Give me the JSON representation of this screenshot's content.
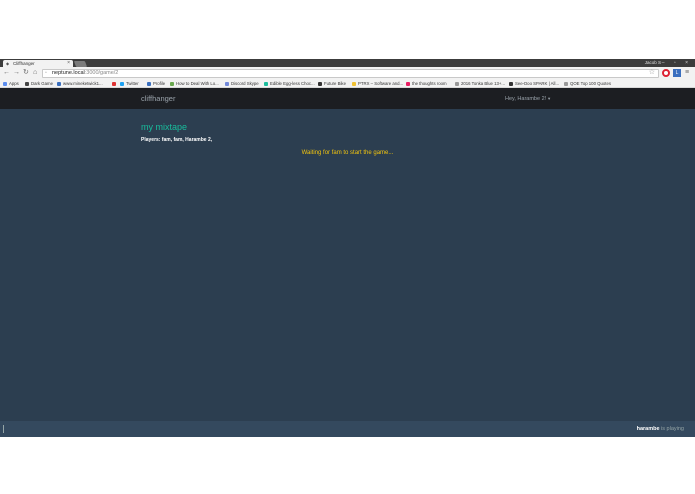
{
  "browser": {
    "tab_title": "Cliffhanger",
    "profile_name": "Jacob S",
    "window_controls": "– ▫ ×",
    "url_host": "neptune.local",
    "url_port_path": ":3000/game/2",
    "bookmarks": [
      {
        "label": "Apps",
        "color": "#5b8def"
      },
      {
        "label": "Dark Game",
        "color": "#444444"
      },
      {
        "label": "www.mineketwick1...",
        "color": "#3a6fbf"
      },
      {
        "label": "",
        "color": "#d33"
      },
      {
        "label": "Twitter",
        "color": "#1da1f2"
      },
      {
        "label": "Profile",
        "color": "#3a6fbf"
      },
      {
        "label": "How to Deal With Lo...",
        "color": "#6aa84f"
      },
      {
        "label": "Discord Skype",
        "color": "#7289da"
      },
      {
        "label": "Edible Egg-less Choc...",
        "color": "#1abc9c"
      },
      {
        "label": "Future Bike",
        "color": "#333333"
      },
      {
        "label": "PTRX – Software and...",
        "color": "#f1c232"
      },
      {
        "label": "the thoughts room",
        "color": "#e91e63"
      },
      {
        "label": "2016 Tonka Blue 13+...",
        "color": "#999999"
      },
      {
        "label": "See-Doo SPARK | All...",
        "color": "#333333"
      },
      {
        "label": "QOE Top 100 Quotes",
        "color": "#999999"
      }
    ]
  },
  "app": {
    "brand": "cliffhanger",
    "user_menu": "Hey, Harambe 2!"
  },
  "game": {
    "title": "my mixtape",
    "players_line": "Players: fam, fam, Harambe 2,",
    "waiting_message": "Waiting for fam to start the game..."
  },
  "footer": {
    "playing_name": "harambe",
    "playing_suffix": " is playing"
  }
}
